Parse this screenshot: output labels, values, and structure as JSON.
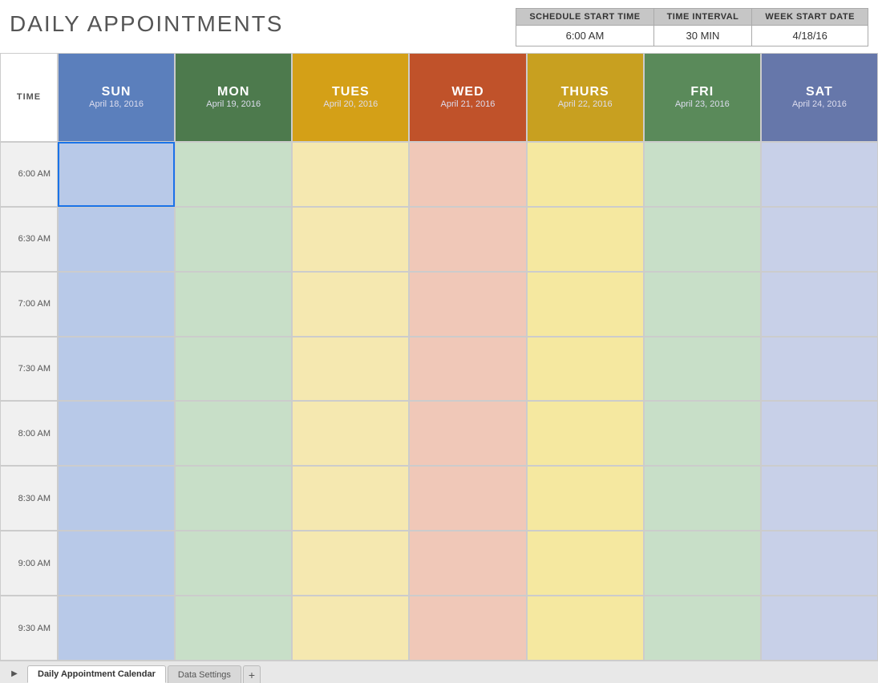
{
  "title": "DAILY APPOINTMENTS",
  "settings": {
    "col1_label": "SCHEDULE START TIME",
    "col2_label": "TIME INTERVAL",
    "col3_label": "WEEK START DATE",
    "col1_value": "6:00 AM",
    "col2_value": "30 MIN",
    "col3_value": "4/18/16"
  },
  "calendar": {
    "time_header": "TIME",
    "days": [
      {
        "key": "sun",
        "name": "SUN",
        "date": "April 18, 2016"
      },
      {
        "key": "mon",
        "name": "MON",
        "date": "April 19, 2016"
      },
      {
        "key": "tue",
        "name": "TUES",
        "date": "April 20, 2016"
      },
      {
        "key": "wed",
        "name": "WED",
        "date": "April 21, 2016"
      },
      {
        "key": "thu",
        "name": "THURS",
        "date": "April 22, 2016"
      },
      {
        "key": "fri",
        "name": "FRI",
        "date": "April 23, 2016"
      },
      {
        "key": "sat",
        "name": "SAT",
        "date": "April 24, 2016"
      }
    ],
    "time_slots": [
      "6:00 AM",
      "6:30 AM",
      "7:00 AM",
      "7:30 AM",
      "8:00 AM",
      "8:30 AM",
      "9:00 AM",
      "9:30 AM"
    ]
  },
  "tabs": [
    {
      "label": "Daily Appointment Calendar",
      "active": true
    },
    {
      "label": "Data Settings",
      "active": false
    }
  ],
  "tab_add_label": "+",
  "tab_arrow_label": "▶"
}
